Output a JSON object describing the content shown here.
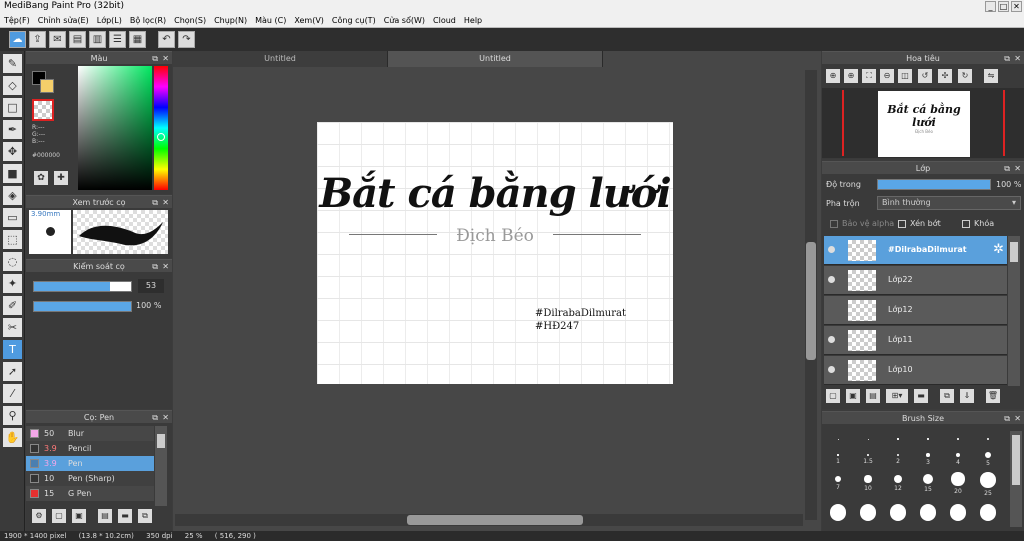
{
  "window": {
    "title": "MediBang Paint Pro (32bit)"
  },
  "menu": [
    "Tệp(F)",
    "Chỉnh sửa(E)",
    "Lớp(L)",
    "Bộ lọc(R)",
    "Chọn(S)",
    "Chụp(N)",
    "Màu (C)",
    "Xem(V)",
    "Công cụ(T)",
    "Cửa sổ(W)",
    "Cloud",
    "Help"
  ],
  "color_panel": {
    "title": "Màu",
    "r": "R:---",
    "g": "G:---",
    "b": "B:---",
    "hex": "#000000"
  },
  "brush_preview": {
    "title": "Xem trước cọ",
    "size": "3.90mm"
  },
  "brush_control": {
    "title": "Kiểm soát cọ",
    "size_value": "53",
    "opacity_value": "100 %",
    "size_fraction": 0.78,
    "opacity_fraction": 1.0
  },
  "brush_list": {
    "title": "Cọ: Pen",
    "items": [
      {
        "size": "50",
        "name": "Blur",
        "color": "#f3a7e8",
        "selected": false
      },
      {
        "size": "3.9",
        "name": "Pencil",
        "color": "#333333",
        "selected": false
      },
      {
        "size": "3.9",
        "name": "Pen",
        "color": "#4a7fb0",
        "selected": true
      },
      {
        "size": "10",
        "name": "Pen (Sharp)",
        "color": "#333333",
        "selected": false
      },
      {
        "size": "15",
        "name": "G Pen",
        "color": "#e53030",
        "selected": false
      }
    ]
  },
  "tabs": [
    {
      "label": "Untitled",
      "active": false
    },
    {
      "label": "Untitled",
      "active": true
    }
  ],
  "document": {
    "title": "Bắt cá bằng lưới",
    "subtitle": "Địch Béo",
    "tag1": "#DilrabaDilmurat",
    "tag2": "#HĐ247"
  },
  "navigator": {
    "title": "Hoa tiêu"
  },
  "layers": {
    "title": "Lớp",
    "opacity_label": "Độ trong",
    "opacity_value": "100 %",
    "blend_label": "Pha trộn",
    "blend_value": "Bình thường",
    "protect_alpha": "Bảo vệ alpha",
    "clipping": "Xén bớt",
    "lock": "Khóa",
    "items": [
      {
        "name": "#DilrabaDilmurat",
        "selected": true
      },
      {
        "name": "Lớp22",
        "selected": false
      },
      {
        "name": "Lớp12",
        "selected": false
      },
      {
        "name": "Lớp11",
        "selected": false
      },
      {
        "name": "Lớp10",
        "selected": false
      }
    ]
  },
  "brush_size": {
    "title": "Brush Size",
    "row1": [
      "1",
      "1.5",
      "2",
      "3",
      "4",
      "5"
    ],
    "row2": [
      "7",
      "10",
      "12",
      "15",
      "20",
      "25"
    ]
  },
  "status": {
    "size": "1900 * 1400 pixel",
    "physical": "(13.8 * 10.2cm)",
    "dpi": "350 dpi",
    "zoom": "25 %",
    "coords": "( 516, 290 )"
  },
  "colors": {
    "accent": "#4f9be0",
    "panel": "#3a3a3a"
  }
}
